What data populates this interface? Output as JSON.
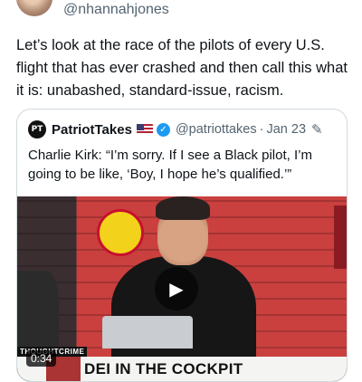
{
  "tweet": {
    "handle": "@nhannahjones",
    "text": "Let’s look at the race of the pilots of every U.S. flight that has ever crashed and then call this what it is: unabashed, standard-issue, racism."
  },
  "quote": {
    "logo_text": "PT",
    "name": "PatriotTakes",
    "handle": "@patriottakes",
    "separator": "·",
    "date": "Jan 23",
    "verified_glyph": "✓",
    "edit_icon": "✎",
    "text": "Charlie Kirk: “I’m sorry. If I see a Black pilot, I’m going to be like, ‘Boy, I hope he’s qualified.’”"
  },
  "video": {
    "tag": "THOUGHTCRIME",
    "headline": "DEI IN THE COCKPIT",
    "duration": "0:34",
    "play_glyph": "▶"
  },
  "colors": {
    "verified": "#1d9bf0",
    "secondary_text": "#536471"
  }
}
